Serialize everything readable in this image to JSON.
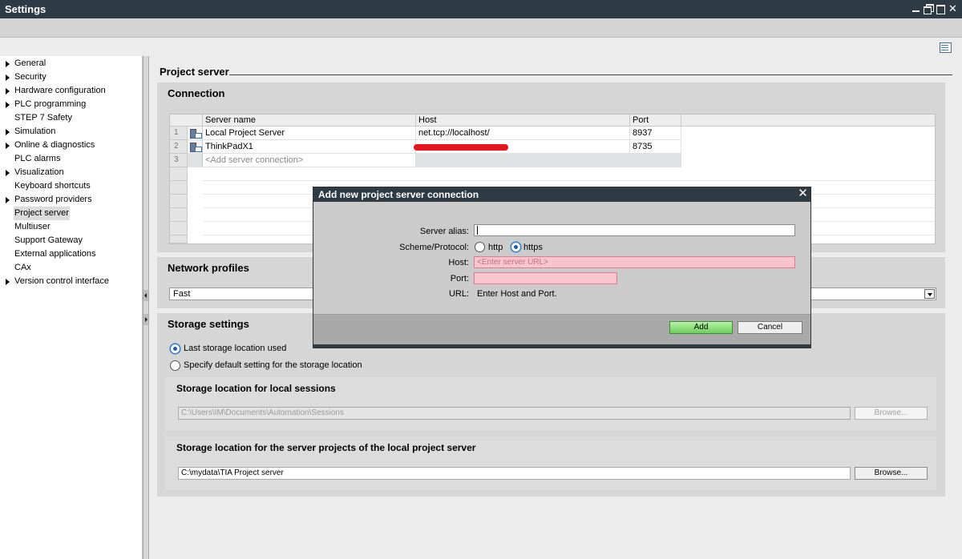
{
  "window": {
    "title": "Settings"
  },
  "sidebar": {
    "items": [
      {
        "label": "General",
        "expandable": true,
        "selected": false
      },
      {
        "label": "Security",
        "expandable": true,
        "selected": false
      },
      {
        "label": "Hardware configuration",
        "expandable": true,
        "selected": false
      },
      {
        "label": "PLC programming",
        "expandable": true,
        "selected": false
      },
      {
        "label": "STEP 7 Safety",
        "expandable": false,
        "selected": false
      },
      {
        "label": "Simulation",
        "expandable": true,
        "selected": false
      },
      {
        "label": "Online & diagnostics",
        "expandable": true,
        "selected": false
      },
      {
        "label": "PLC alarms",
        "expandable": false,
        "selected": false
      },
      {
        "label": "Visualization",
        "expandable": true,
        "selected": false
      },
      {
        "label": "Keyboard shortcuts",
        "expandable": false,
        "selected": false
      },
      {
        "label": "Password providers",
        "expandable": true,
        "selected": false
      },
      {
        "label": "Project server",
        "expandable": false,
        "selected": true
      },
      {
        "label": "Multiuser",
        "expandable": false,
        "selected": false
      },
      {
        "label": "Support Gateway",
        "expandable": false,
        "selected": false
      },
      {
        "label": "External applications",
        "expandable": false,
        "selected": false
      },
      {
        "label": "CAx",
        "expandable": false,
        "selected": false
      },
      {
        "label": "Version control interface",
        "expandable": true,
        "selected": false
      }
    ]
  },
  "main": {
    "section_title": "Project server",
    "connection": {
      "title": "Connection",
      "columns": [
        "Server name",
        "Host",
        "Port"
      ],
      "rows": [
        {
          "num": "1",
          "name": "Local Project Server",
          "host": "net.tcp://localhost/",
          "port": "8937"
        },
        {
          "num": "2",
          "name": "ThinkPadX1",
          "host": "",
          "port": "8735"
        }
      ],
      "add_row_num": "3",
      "add_placeholder": "<Add server connection>"
    },
    "network_profiles": {
      "title": "Network profiles",
      "selected": "Fast"
    },
    "storage": {
      "title": "Storage settings",
      "option_last": "Last storage location used",
      "option_default": "Specify default setting for the storage location",
      "local_sessions": {
        "title": "Storage location for local sessions",
        "path": "C:\\Users\\IM\\Documents\\Automation\\Sessions",
        "browse": "Browse..."
      },
      "server_projects": {
        "title": "Storage location for the server projects of the local project server",
        "path": "C:\\mydata\\TIA Project server",
        "browse": "Browse..."
      }
    }
  },
  "dialog": {
    "title": "Add new project server connection",
    "alias_label": "Server alias:",
    "alias_value": "",
    "scheme_label": "Scheme/Protocol:",
    "scheme_http": "http",
    "scheme_https": "https",
    "scheme_selected": "https",
    "host_label": "Host:",
    "host_placeholder": "<Enter server URL>",
    "port_label": "Port:",
    "port_value": "",
    "url_label": "URL:",
    "url_value": "Enter Host and Port.",
    "add_label": "Add",
    "cancel_label": "Cancel"
  },
  "colors": {
    "titlebar": "#2f3b44",
    "invalid_field": "#f8c5cf",
    "add_button": "#6fcf5a",
    "radio_accent": "#1d5fa8"
  }
}
